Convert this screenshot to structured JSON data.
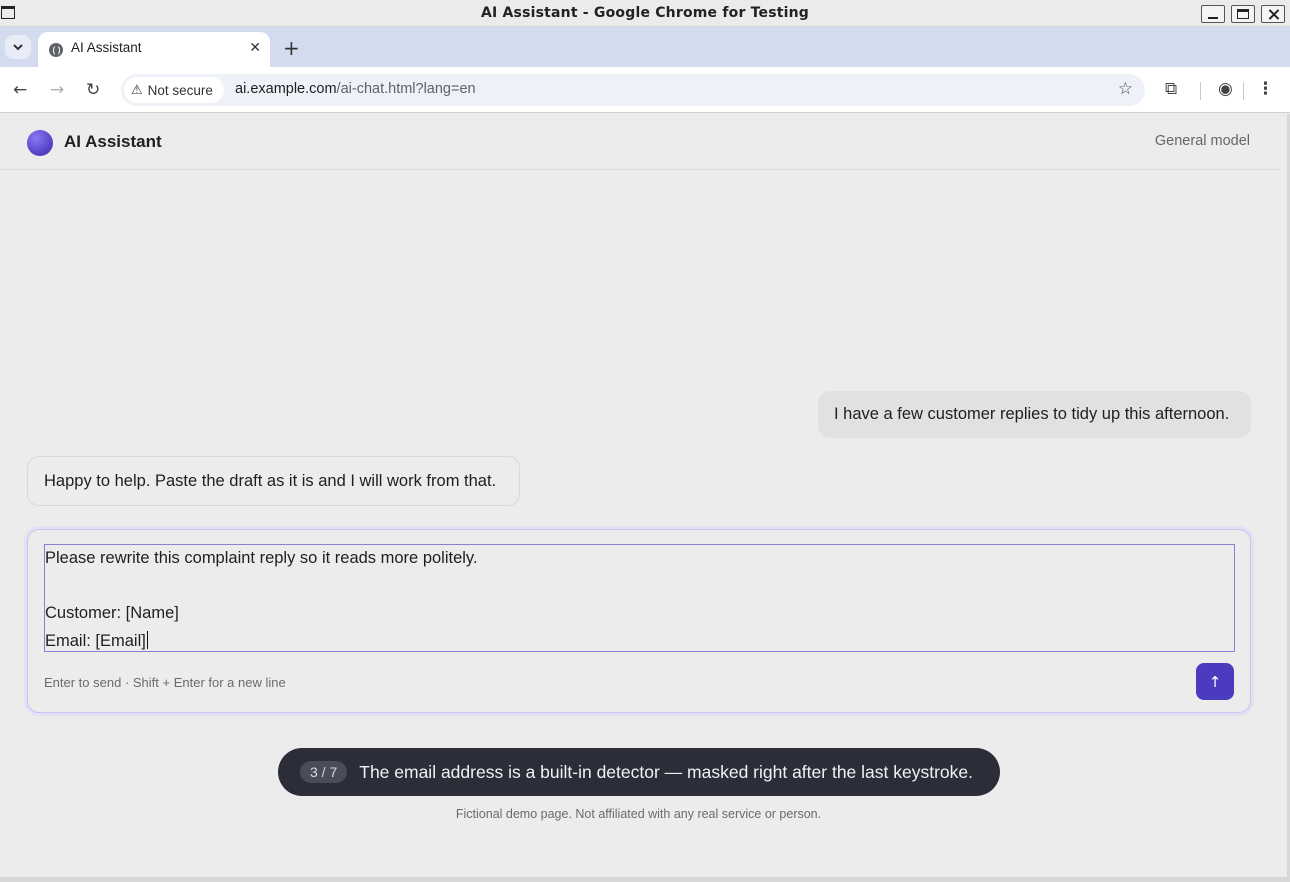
{
  "window": {
    "title": "AI Assistant - Google Chrome for Testing"
  },
  "browser": {
    "tab_title": "AI Assistant",
    "security_chip": "Not secure",
    "url_host": "ai.example.com",
    "url_path": "/ai-chat.html?lang=en"
  },
  "app": {
    "title": "AI Assistant",
    "model": "General model",
    "accent_color": "#4b3bbf"
  },
  "messages": [
    {
      "role": "user",
      "text": "I have a few customer replies to tidy up this afternoon."
    },
    {
      "role": "assistant",
      "text": "Happy to help. Paste the draft as it is and I will work from that."
    }
  ],
  "composer": {
    "lines": [
      "Please rewrite this complaint reply so it reads more politely.",
      "",
      "Customer: [Name]",
      "Email: [Email]"
    ],
    "hint": "Enter to send · Shift + Enter for a new line",
    "send_icon": "arrow-up-icon",
    "send_glyph": "↑"
  },
  "toast": {
    "step": "3 / 7",
    "text": "The email address is a built-in detector — masked right after the last keystroke."
  },
  "footer": {
    "note": "Fictional demo page. Not affiliated with any real service or person."
  }
}
